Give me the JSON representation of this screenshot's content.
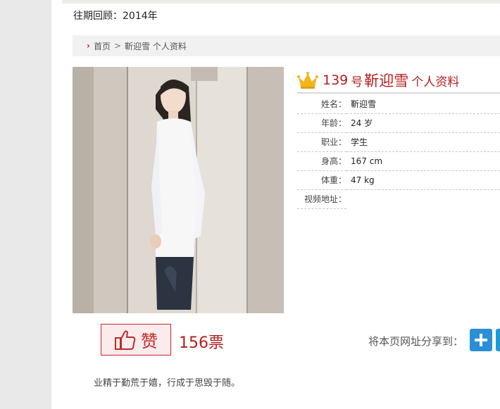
{
  "archive": {
    "label": "往期回顾：2014年"
  },
  "breadcrumb": {
    "home": "首页",
    "separator": ">",
    "current": "靳迎雪 个人资料"
  },
  "profile": {
    "number": "139",
    "hao": "号",
    "name": "靳迎雪",
    "suffix": "个人资料",
    "fields": [
      {
        "label": "姓名：",
        "value": "靳迎雪"
      },
      {
        "label": "年龄：",
        "value": "24 岁"
      },
      {
        "label": "职业：",
        "value": "学生"
      },
      {
        "label": "身高：",
        "value": "167 cm"
      },
      {
        "label": "体重：",
        "value": "47 kg"
      },
      {
        "label": "视频地址：",
        "value": ""
      }
    ]
  },
  "vote": {
    "button_label": "赞",
    "count": "156票"
  },
  "share": {
    "label": "将本页网址分享到："
  },
  "motto": "业精于勤荒于嬉，行成于思毁于随。",
  "icons": {
    "crown": "crown-icon",
    "thumb": "thumbs-up-icon",
    "plus": "plus-icon",
    "chevron": "chevron-right-icon"
  },
  "colors": {
    "accent": "#b3201f",
    "share_blue": "#2b8fd6",
    "crown_gold": "#f2b51c"
  }
}
